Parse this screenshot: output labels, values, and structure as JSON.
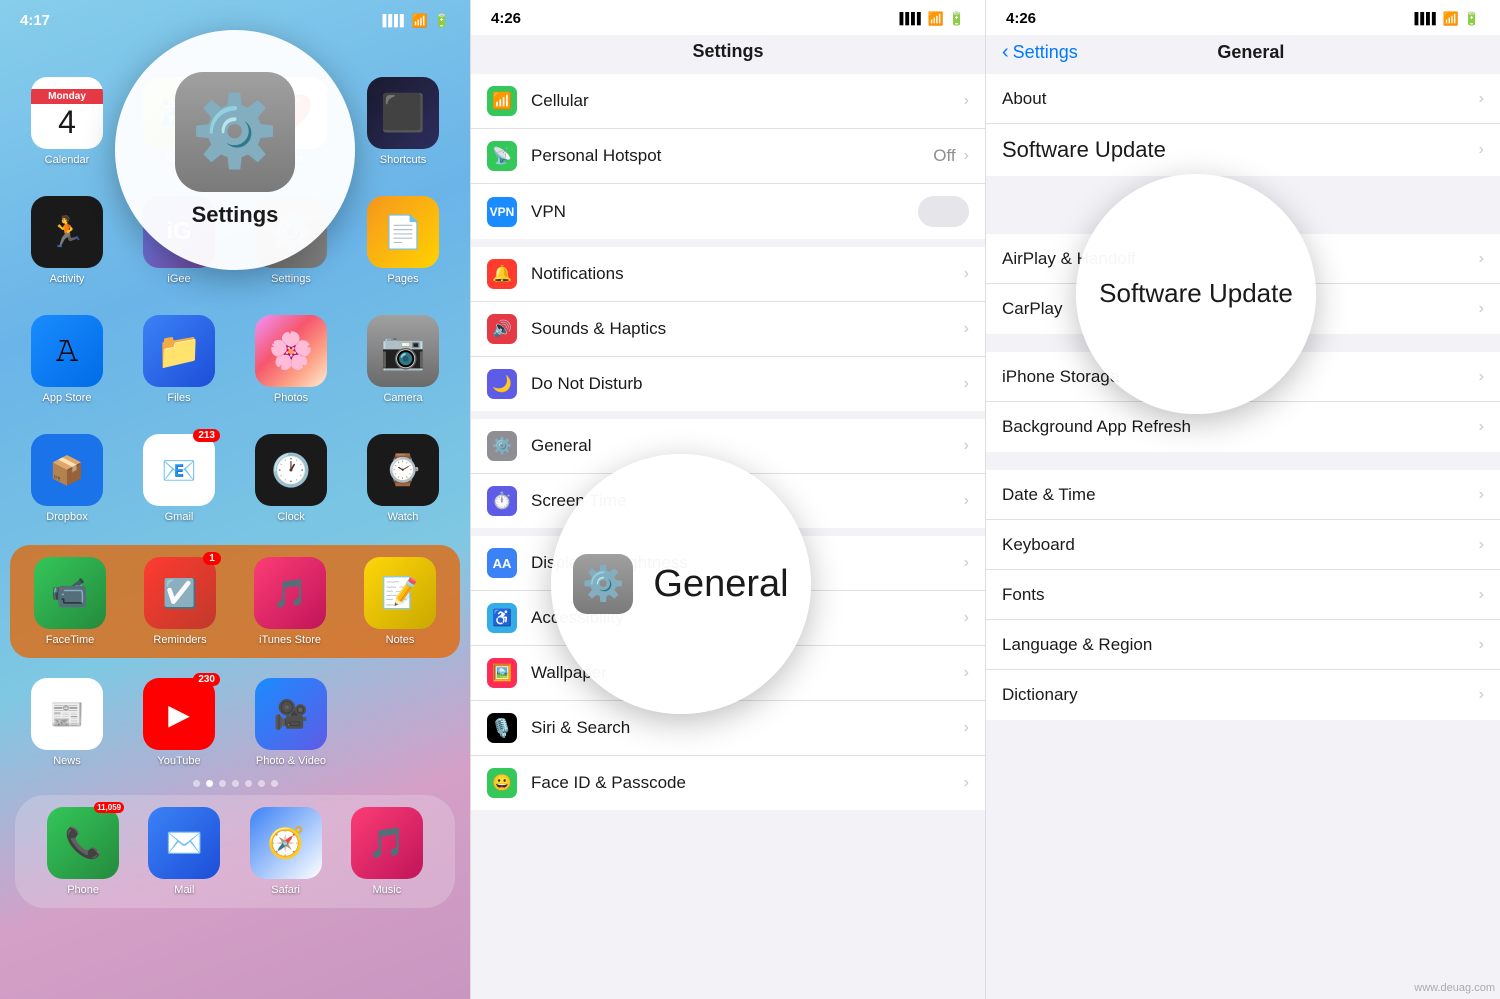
{
  "home": {
    "status_time": "4:17",
    "status_signal": "▌▌▌",
    "status_wifi": "WiFi",
    "status_battery": "🔋",
    "settings_label": "Settings",
    "apps_row1": [
      {
        "label": "Calendar",
        "type": "calendar",
        "day": "Monday",
        "date": "4"
      },
      {
        "label": "Maps",
        "type": "maps"
      },
      {
        "label": "Health",
        "type": "health"
      },
      {
        "label": "Shortcuts",
        "type": "shortcuts"
      }
    ],
    "apps_row2": [
      {
        "label": "Activity",
        "type": "activity"
      },
      {
        "label": "iGee",
        "type": "igee"
      },
      {
        "label": "",
        "type": "settings_hidden"
      },
      {
        "label": "Pages",
        "type": "pages"
      }
    ],
    "apps_row3": [
      {
        "label": "App Store",
        "type": "appstore"
      },
      {
        "label": "Files",
        "type": "files"
      },
      {
        "label": "Photos",
        "type": "photos"
      },
      {
        "label": "Camera",
        "type": "camera"
      }
    ],
    "apps_row4": [
      {
        "label": "Dropbox",
        "type": "dropbox"
      },
      {
        "label": "Gmail",
        "type": "gmail",
        "badge": "213"
      },
      {
        "label": "Clock",
        "type": "clock"
      },
      {
        "label": "Watch",
        "type": "watch"
      }
    ],
    "folder_row": [
      {
        "label": "FaceTime",
        "type": "facetime"
      },
      {
        "label": "Reminders",
        "type": "reminders",
        "badge": "1"
      },
      {
        "label": "iTunes Store",
        "type": "itunesstore"
      },
      {
        "label": "Notes",
        "type": "notes"
      }
    ],
    "row5": [
      {
        "label": "News",
        "type": "news"
      },
      {
        "label": "YouTube",
        "type": "youtube",
        "badge": "230"
      },
      {
        "label": "Photo & Video",
        "type": "photovideo"
      }
    ],
    "dock": [
      {
        "label": "Phone",
        "type": "phone",
        "badge": "11,059"
      },
      {
        "label": "Mail",
        "type": "mail"
      },
      {
        "label": "Safari",
        "type": "safari"
      },
      {
        "label": "Music",
        "type": "music"
      }
    ]
  },
  "settings": {
    "status_time": "4:26",
    "status_signal": "▌▌▌",
    "title": "Settings",
    "rows": [
      {
        "icon": "green",
        "label": "Cellular",
        "chevron": true
      },
      {
        "icon": "green",
        "label": "Personal Hotspot",
        "value": "Off",
        "chevron": true
      },
      {
        "icon": "blue-vpn",
        "label": "VPN",
        "toggle": true
      },
      {
        "icon": "red",
        "label": "Notifications",
        "chevron": true
      },
      {
        "icon": "red-dark",
        "label": "Sounds & Haptics",
        "chevron": true
      },
      {
        "icon": "moon",
        "label": "Do Not Disturb",
        "chevron": true
      },
      {
        "icon": "gray",
        "label": "General",
        "chevron": true
      },
      {
        "icon": "gray",
        "label": "Screen Time",
        "chevron": true
      },
      {
        "icon": "gray",
        "label": "Display & Brightness",
        "chevron": true
      },
      {
        "icon": "teal",
        "label": "Accessibility",
        "chevron": true
      },
      {
        "icon": "pink",
        "label": "Wallpaper",
        "chevron": true
      },
      {
        "icon": "pink",
        "label": "Siri & Search",
        "chevron": true
      },
      {
        "icon": "green",
        "label": "Face ID & Passcode",
        "chevron": true
      }
    ],
    "general_overlay_label": "General"
  },
  "general": {
    "status_time": "4:26",
    "back_label": "Settings",
    "title": "General",
    "rows_section1": [
      {
        "label": "About",
        "chevron": true
      },
      {
        "label": "Software Update",
        "chevron": true,
        "highlighted": true
      }
    ],
    "rows_section2": [
      {
        "label": "AirPlay & Handoff",
        "chevron": true
      },
      {
        "label": "CarPlay",
        "chevron": true
      }
    ],
    "rows_section3": [
      {
        "label": "iPhone Storage",
        "chevron": true
      },
      {
        "label": "Background App Refresh",
        "chevron": true
      }
    ],
    "rows_section4": [
      {
        "label": "Date & Time",
        "chevron": true
      },
      {
        "label": "Keyboard",
        "chevron": true
      },
      {
        "label": "Fonts",
        "chevron": true
      },
      {
        "label": "Language & Region",
        "chevron": true
      },
      {
        "label": "Dictionary",
        "chevron": true
      }
    ],
    "software_update_label": "Software Update"
  },
  "watermark": "www.deuag.com"
}
